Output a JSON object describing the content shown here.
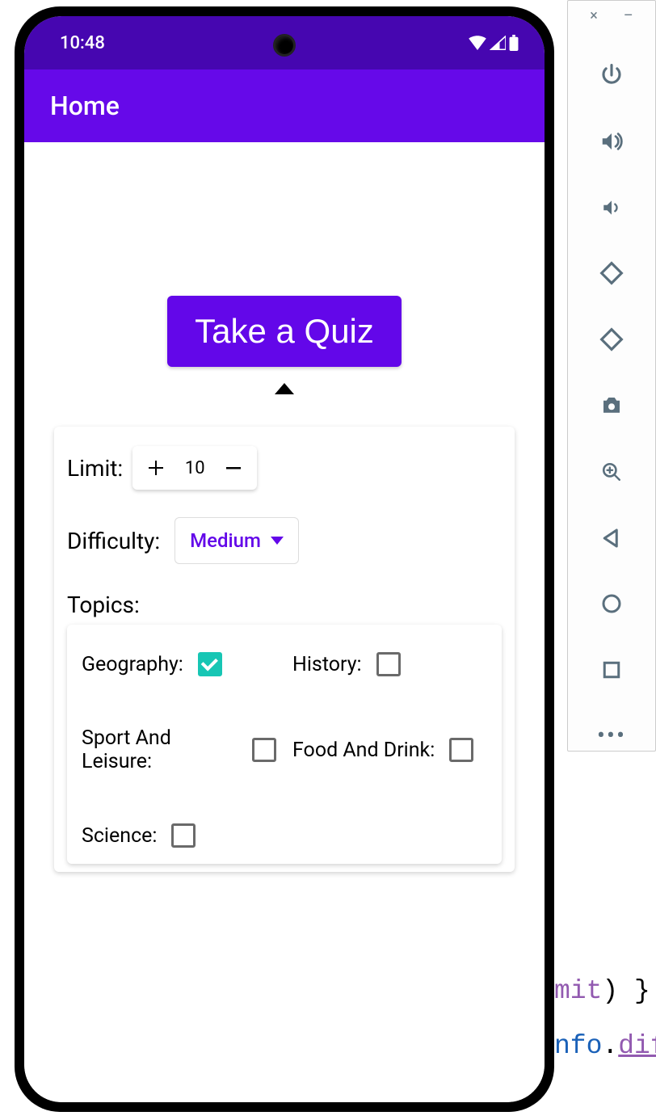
{
  "statusBar": {
    "time": "10:48"
  },
  "appBar": {
    "title": "Home"
  },
  "main": {
    "takeQuizLabel": "Take a Quiz",
    "limitLabel": "Limit:",
    "limitValue": "10",
    "difficultyLabel": "Difficulty:",
    "difficultyValue": "Medium",
    "topicsLabel": "Topics:",
    "topics": [
      {
        "label": "Geography:",
        "checked": true
      },
      {
        "label": "History:",
        "checked": false
      },
      {
        "label": "Sport And Leisure:",
        "checked": false
      },
      {
        "label": "Food And Drink:",
        "checked": false
      },
      {
        "label": "Science:",
        "checked": false
      }
    ]
  },
  "bgCode": {
    "line1a": "mit",
    "line1b": ") }",
    "line2a": "nfo",
    "line2b": ".",
    "line2c": "dif"
  },
  "emuWin": {
    "close": "×",
    "min": "–"
  }
}
